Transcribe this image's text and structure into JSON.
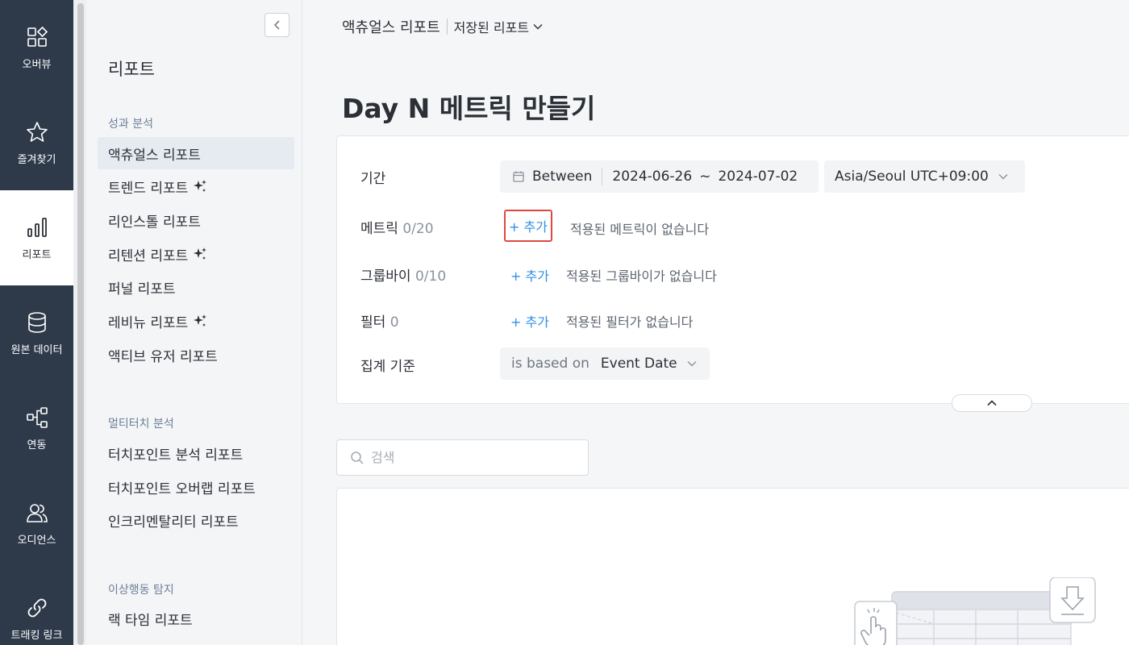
{
  "nav": {
    "items": [
      {
        "label": "오버뷰",
        "icon": "overview-icon"
      },
      {
        "label": "즐겨찾기",
        "icon": "star-icon"
      },
      {
        "label": "리포트",
        "icon": "bar-chart-icon"
      },
      {
        "label": "원본 데이터",
        "icon": "database-icon"
      },
      {
        "label": "연동",
        "icon": "integration-icon"
      },
      {
        "label": "오디언스",
        "icon": "audience-icon"
      },
      {
        "label": "트래킹 링크",
        "icon": "link-icon"
      }
    ]
  },
  "subnav": {
    "title": "리포트",
    "sections": [
      {
        "title": "성과 분석",
        "items": [
          {
            "label": "액츄얼스 리포트"
          },
          {
            "label": "트렌드 리포트"
          },
          {
            "label": "리인스톨 리포트"
          },
          {
            "label": "리텐션 리포트"
          },
          {
            "label": "퍼널 리포트"
          },
          {
            "label": "레비뉴 리포트"
          },
          {
            "label": "액티브 유저 리포트"
          }
        ]
      },
      {
        "title": "멀티터치 분석",
        "items": [
          {
            "label": "터치포인트 분석 리포트"
          },
          {
            "label": "터치포인트 오버랩 리포트"
          },
          {
            "label": "인크리멘탈리티 리포트"
          }
        ]
      },
      {
        "title": "이상행동 탐지",
        "items": [
          {
            "label": "랙 타임 리포트"
          }
        ]
      }
    ]
  },
  "header": {
    "breadcrumb": "액츄얼스 리포트",
    "saved_reports": "저장된 리포트",
    "page_title": "Day N 메트릭 만들기"
  },
  "form": {
    "period": {
      "label": "기간",
      "mode": "Between",
      "start": "2024-06-26",
      "separator": "~",
      "end": "2024-07-02",
      "timezone": "Asia/Seoul UTC+09:00"
    },
    "metric": {
      "label": "메트릭",
      "count": "0/20",
      "add": "+ 추가",
      "empty": "적용된 메트릭이 없습니다"
    },
    "groupby": {
      "label": "그룹바이",
      "count": "0/10",
      "add": "+ 추가",
      "empty": "적용된 그룹바이가 없습니다"
    },
    "filter": {
      "label": "필터",
      "count": "0",
      "add": "+ 추가",
      "empty": "적용된 필터가 없습니다"
    },
    "aggregation": {
      "label": "집계 기준",
      "prefix": "is based on",
      "value": "Event Date"
    }
  },
  "search": {
    "placeholder": "검색"
  },
  "colors": {
    "nav_bg": "#2e3a4a",
    "accent": "#2f8fe6",
    "highlight": "#e0483e"
  }
}
